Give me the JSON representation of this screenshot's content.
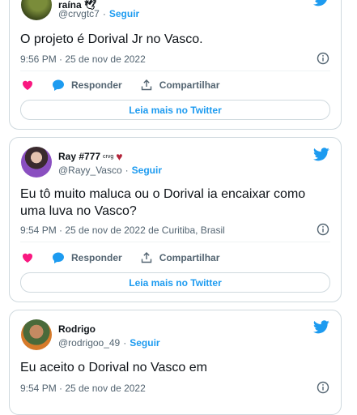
{
  "tweets": [
    {
      "name": "raína 🕊",
      "handle": "@crvgtc7",
      "follow": "Seguir",
      "text": "O projeto é Dorival Jr no Vasco.",
      "meta": "9:56 PM · 25 de nov de 2022",
      "reply": "Responder",
      "share": "Compartilhar",
      "read_more": "Leia mais no Twitter"
    },
    {
      "name": "Ray #777",
      "name_badge": "crvg",
      "heart": "♥",
      "handle": "@Rayy_Vasco",
      "follow": "Seguir",
      "text": "Eu tô muito maluca ou o Dorival ia encaixar como uma luva no Vasco?",
      "meta": "9:54 PM · 25 de nov de 2022 de Curitiba, Brasil",
      "reply": "Responder",
      "share": "Compartilhar",
      "read_more": "Leia mais no Twitter"
    },
    {
      "name": "Rodrigo",
      "handle": "@rodrigoo_49",
      "follow": "Seguir",
      "text": "Eu aceito o Dorival no Vasco em",
      "meta": "9:54 PM · 25 de nov de 2022"
    }
  ],
  "colors": {
    "accent": "#1d9bf0",
    "like": "#f91880",
    "heart_emoji": "#b3243a",
    "muted": "#536471",
    "border": "#cfd9de"
  },
  "icons": [
    "twitter-bird-icon",
    "info-icon",
    "like-heart-icon",
    "reply-bubble-icon",
    "share-icon"
  ]
}
